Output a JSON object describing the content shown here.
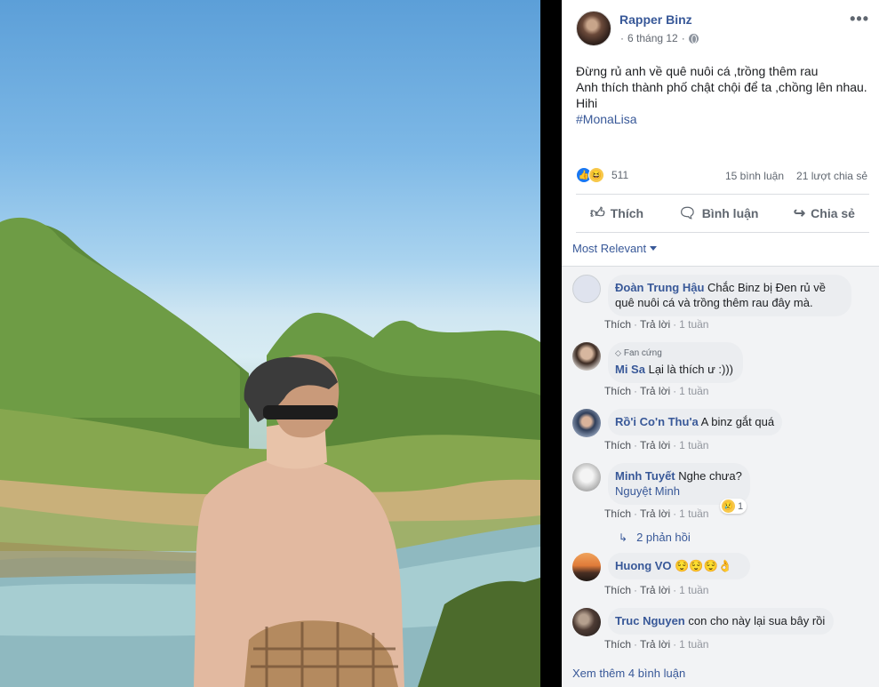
{
  "post": {
    "author": "Rapper Binz",
    "date": "6 tháng 12",
    "date_prefix": "·",
    "text_lines": [
      "Đừng rủ anh về quê nuôi cá ,trồng thêm rau",
      "Anh thích thành phố chật chội để ta ,chồng lên nhau.",
      "Hihi"
    ],
    "hashtag": "#MonaLisa",
    "more_label": "•••"
  },
  "stats": {
    "reaction_count": "511",
    "comments": "15 bình luận",
    "shares": "21 lượt chia sẻ"
  },
  "actions": {
    "like": "Thích",
    "comment": "Bình luận",
    "share": "Chia sẻ"
  },
  "sort": {
    "label": "Most Relevant"
  },
  "comments": [
    {
      "name": "Đoàn Trung Hậu",
      "text_line1": "Chắc Binz bị Đen rủ về",
      "text_line2": "quê nuôi cá và trồng thêm rau đây mà.",
      "like": "Thích",
      "reply": "Trả lời",
      "time": "1 tuần"
    },
    {
      "badge": "Fan cứng",
      "name": "Mi Sa",
      "text": "Lại là thích ư :)))",
      "like": "Thích",
      "reply": "Trả lời",
      "time": "1 tuần"
    },
    {
      "name": "Rồ'i Co'n Thu'a",
      "text": "A binz gắt quá",
      "like": "Thích",
      "reply": "Trả lời",
      "time": "1 tuần"
    },
    {
      "name": "Minh Tuyết",
      "text": "Nghe chưa?",
      "mention": "Nguyệt Minh",
      "like": "Thích",
      "reply": "Trả lời",
      "time": "1 tuần",
      "reaction_count": "1"
    },
    {
      "name": "Huong VO",
      "text": "😌😌😌👌",
      "like": "Thích",
      "reply": "Trả lời",
      "time": "1 tuần"
    },
    {
      "name": "Truc Nguyen",
      "text": "con cho này lại sua bây rồi",
      "like": "Thích",
      "reply": "Trả lời",
      "time": "1 tuần"
    }
  ],
  "replies": {
    "label": "2 phản hồi"
  },
  "see_more": "Xem thêm 4 bình luận",
  "colors": {
    "link_blue": "#385898",
    "bubble_gray": "#ebedf0",
    "panel_bg": "#f2f3f5",
    "like_blue": "#1877f2"
  }
}
